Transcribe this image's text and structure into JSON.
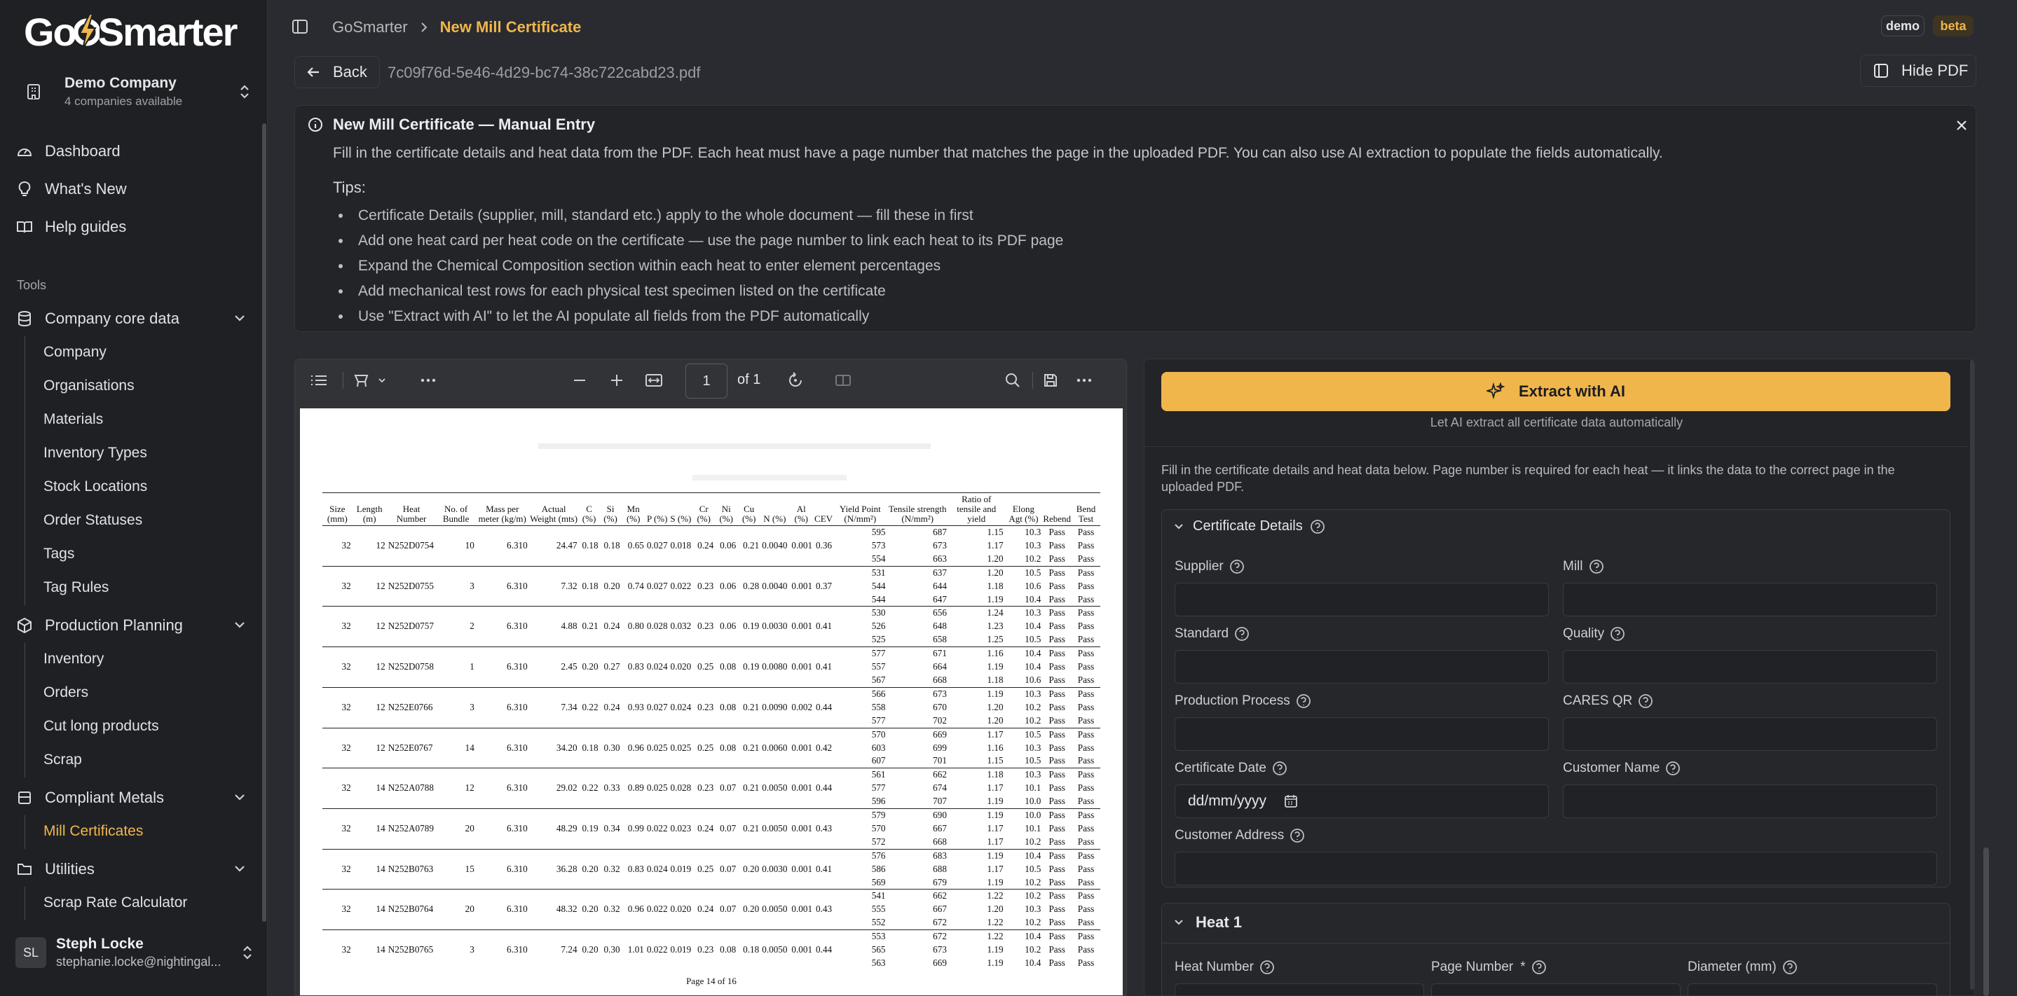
{
  "brand": {
    "logo_text_pre": "Go",
    "logo_text_post": "Smarter"
  },
  "company": {
    "name": "Demo Company",
    "sub": "4 companies available"
  },
  "nav": {
    "dashboard": "Dashboard",
    "whats_new": "What's New",
    "help": "Help guides"
  },
  "tools_label": "Tools",
  "groups": {
    "core": {
      "label": "Company core data",
      "items": [
        "Company",
        "Organisations",
        "Materials",
        "Inventory Types",
        "Stock Locations",
        "Order Statuses",
        "Tags",
        "Tag Rules"
      ]
    },
    "planning": {
      "label": "Production Planning",
      "items": [
        "Inventory",
        "Orders",
        "Cut long products",
        "Scrap"
      ]
    },
    "metals": {
      "label": "Compliant Metals",
      "items": [
        "Mill Certificates"
      ]
    },
    "utilities": {
      "label": "Utilities",
      "items": [
        "Scrap Rate Calculator"
      ]
    }
  },
  "user": {
    "initials": "SL",
    "name": "Steph Locke",
    "email": "stephanie.locke@nightingal..."
  },
  "breadcrumb": {
    "root": "GoSmarter",
    "current": "New Mill Certificate"
  },
  "badges": {
    "demo": "demo",
    "beta": "beta"
  },
  "toolbar": {
    "back": "Back",
    "filename": "7c09f76d-5e46-4d29-bc74-38c722cabd23.pdf",
    "hide_pdf": "Hide PDF"
  },
  "info": {
    "title": "New Mill Certificate — Manual Entry",
    "desc": "Fill in the certificate details and heat data from the PDF. Each heat must have a page number that matches the page in the uploaded PDF. You can also use AI extraction to populate the fields automatically.",
    "tips_heading": "Tips:",
    "tips": [
      "Certificate Details (supplier, mill, standard etc.) apply to the whole document — fill these in first",
      "Add one heat card per heat code on the certificate — use the page number to link each heat to its PDF page",
      "Expand the Chemical Composition section within each heat to enter element percentages",
      "Add mechanical test rows for each physical test specimen listed on the certificate",
      "Use \"Extract with AI\" to let the AI populate all fields from the PDF automatically"
    ]
  },
  "pdf_viewer": {
    "page": "1",
    "of_pages": "of 1",
    "headers": [
      "Size (mm)",
      "Length (m)",
      "Heat Number",
      "No. of Bundle",
      "Mass per meter (kg/m)",
      "Actual Weight (mts)",
      "C (%)",
      "Si (%)",
      "Mn (%)",
      "P (%)",
      "S (%)",
      "Cr (%)",
      "Ni (%)",
      "Cu (%)",
      "N (%)",
      "Al (%)",
      "CEV",
      "Yield Point (N/mm²)",
      "Tensile strength (N/mm²)",
      "Ratio of tensile and yield",
      "Elong Agt (%)",
      "Rebend",
      "Bend Test"
    ],
    "rows": [
      {
        "size": "32",
        "len": "12",
        "heat": "N252D0754",
        "bundle": "10",
        "mass": "6.310",
        "weight": "24.47",
        "c": "0.18",
        "si": "0.18",
        "mn": "0.65",
        "p": "0.027",
        "s": "0.018",
        "cr": "0.24",
        "ni": "0.06",
        "cu": "0.21",
        "n": "0.0040",
        "al": "0.001",
        "cev": "0.36",
        "tests": [
          [
            "595",
            "687",
            "1.15",
            "10.3",
            "Pass",
            "Pass"
          ],
          [
            "573",
            "673",
            "1.17",
            "10.3",
            "Pass",
            "Pass"
          ],
          [
            "554",
            "663",
            "1.20",
            "10.2",
            "Pass",
            "Pass"
          ]
        ]
      },
      {
        "size": "32",
        "len": "12",
        "heat": "N252D0755",
        "bundle": "3",
        "mass": "6.310",
        "weight": "7.32",
        "c": "0.18",
        "si": "0.20",
        "mn": "0.74",
        "p": "0.027",
        "s": "0.022",
        "cr": "0.23",
        "ni": "0.06",
        "cu": "0.28",
        "n": "0.0040",
        "al": "0.001",
        "cev": "0.37",
        "tests": [
          [
            "531",
            "637",
            "1.20",
            "10.5",
            "Pass",
            "Pass"
          ],
          [
            "544",
            "644",
            "1.18",
            "10.6",
            "Pass",
            "Pass"
          ],
          [
            "544",
            "647",
            "1.19",
            "10.4",
            "Pass",
            "Pass"
          ]
        ]
      },
      {
        "size": "32",
        "len": "12",
        "heat": "N252D0757",
        "bundle": "2",
        "mass": "6.310",
        "weight": "4.88",
        "c": "0.21",
        "si": "0.24",
        "mn": "0.80",
        "p": "0.028",
        "s": "0.032",
        "cr": "0.23",
        "ni": "0.06",
        "cu": "0.19",
        "n": "0.0030",
        "al": "0.001",
        "cev": "0.41",
        "tests": [
          [
            "530",
            "656",
            "1.24",
            "10.3",
            "Pass",
            "Pass"
          ],
          [
            "526",
            "648",
            "1.23",
            "10.4",
            "Pass",
            "Pass"
          ],
          [
            "525",
            "658",
            "1.25",
            "10.5",
            "Pass",
            "Pass"
          ]
        ]
      },
      {
        "size": "32",
        "len": "12",
        "heat": "N252D0758",
        "bundle": "1",
        "mass": "6.310",
        "weight": "2.45",
        "c": "0.20",
        "si": "0.27",
        "mn": "0.83",
        "p": "0.024",
        "s": "0.020",
        "cr": "0.25",
        "ni": "0.08",
        "cu": "0.19",
        "n": "0.0080",
        "al": "0.001",
        "cev": "0.41",
        "tests": [
          [
            "577",
            "671",
            "1.16",
            "10.4",
            "Pass",
            "Pass"
          ],
          [
            "557",
            "664",
            "1.19",
            "10.4",
            "Pass",
            "Pass"
          ],
          [
            "567",
            "668",
            "1.18",
            "10.6",
            "Pass",
            "Pass"
          ]
        ]
      },
      {
        "size": "32",
        "len": "12",
        "heat": "N252E0766",
        "bundle": "3",
        "mass": "6.310",
        "weight": "7.34",
        "c": "0.22",
        "si": "0.24",
        "mn": "0.93",
        "p": "0.027",
        "s": "0.024",
        "cr": "0.23",
        "ni": "0.08",
        "cu": "0.21",
        "n": "0.0090",
        "al": "0.002",
        "cev": "0.44",
        "tests": [
          [
            "566",
            "673",
            "1.19",
            "10.3",
            "Pass",
            "Pass"
          ],
          [
            "558",
            "670",
            "1.20",
            "10.2",
            "Pass",
            "Pass"
          ],
          [
            "577",
            "702",
            "1.20",
            "10.2",
            "Pass",
            "Pass"
          ]
        ]
      },
      {
        "size": "32",
        "len": "12",
        "heat": "N252E0767",
        "bundle": "14",
        "mass": "6.310",
        "weight": "34.20",
        "c": "0.18",
        "si": "0.30",
        "mn": "0.96",
        "p": "0.025",
        "s": "0.025",
        "cr": "0.25",
        "ni": "0.08",
        "cu": "0.21",
        "n": "0.0060",
        "al": "0.001",
        "cev": "0.42",
        "tests": [
          [
            "570",
            "669",
            "1.17",
            "10.5",
            "Pass",
            "Pass"
          ],
          [
            "603",
            "699",
            "1.16",
            "10.3",
            "Pass",
            "Pass"
          ],
          [
            "607",
            "701",
            "1.15",
            "10.5",
            "Pass",
            "Pass"
          ]
        ]
      },
      {
        "size": "32",
        "len": "14",
        "heat": "N252A0788",
        "bundle": "12",
        "mass": "6.310",
        "weight": "29.02",
        "c": "0.22",
        "si": "0.33",
        "mn": "0.89",
        "p": "0.025",
        "s": "0.028",
        "cr": "0.23",
        "ni": "0.07",
        "cu": "0.21",
        "n": "0.0050",
        "al": "0.001",
        "cev": "0.44",
        "tests": [
          [
            "561",
            "662",
            "1.18",
            "10.3",
            "Pass",
            "Pass"
          ],
          [
            "577",
            "674",
            "1.17",
            "10.1",
            "Pass",
            "Pass"
          ],
          [
            "596",
            "707",
            "1.19",
            "10.0",
            "Pass",
            "Pass"
          ]
        ]
      },
      {
        "size": "32",
        "len": "14",
        "heat": "N252A0789",
        "bundle": "20",
        "mass": "6.310",
        "weight": "48.29",
        "c": "0.19",
        "si": "0.34",
        "mn": "0.99",
        "p": "0.022",
        "s": "0.023",
        "cr": "0.24",
        "ni": "0.07",
        "cu": "0.21",
        "n": "0.0050",
        "al": "0.001",
        "cev": "0.43",
        "tests": [
          [
            "579",
            "690",
            "1.19",
            "10.0",
            "Pass",
            "Pass"
          ],
          [
            "570",
            "667",
            "1.17",
            "10.1",
            "Pass",
            "Pass"
          ],
          [
            "572",
            "668",
            "1.17",
            "10.2",
            "Pass",
            "Pass"
          ]
        ]
      },
      {
        "size": "32",
        "len": "14",
        "heat": "N252B0763",
        "bundle": "15",
        "mass": "6.310",
        "weight": "36.28",
        "c": "0.20",
        "si": "0.32",
        "mn": "0.83",
        "p": "0.024",
        "s": "0.019",
        "cr": "0.25",
        "ni": "0.07",
        "cu": "0.20",
        "n": "0.0030",
        "al": "0.001",
        "cev": "0.41",
        "tests": [
          [
            "576",
            "683",
            "1.19",
            "10.4",
            "Pass",
            "Pass"
          ],
          [
            "586",
            "688",
            "1.17",
            "10.5",
            "Pass",
            "Pass"
          ],
          [
            "569",
            "679",
            "1.19",
            "10.2",
            "Pass",
            "Pass"
          ]
        ]
      },
      {
        "size": "32",
        "len": "14",
        "heat": "N252B0764",
        "bundle": "20",
        "mass": "6.310",
        "weight": "48.32",
        "c": "0.20",
        "si": "0.32",
        "mn": "0.96",
        "p": "0.022",
        "s": "0.020",
        "cr": "0.24",
        "ni": "0.07",
        "cu": "0.20",
        "n": "0.0050",
        "al": "0.001",
        "cev": "0.43",
        "tests": [
          [
            "541",
            "662",
            "1.22",
            "10.2",
            "Pass",
            "Pass"
          ],
          [
            "555",
            "667",
            "1.20",
            "10.3",
            "Pass",
            "Pass"
          ],
          [
            "552",
            "672",
            "1.22",
            "10.2",
            "Pass",
            "Pass"
          ]
        ]
      },
      {
        "size": "32",
        "len": "14",
        "heat": "N252B0765",
        "bundle": "3",
        "mass": "6.310",
        "weight": "7.24",
        "c": "0.20",
        "si": "0.30",
        "mn": "1.01",
        "p": "0.022",
        "s": "0.019",
        "cr": "0.23",
        "ni": "0.08",
        "cu": "0.18",
        "n": "0.0050",
        "al": "0.001",
        "cev": "0.44",
        "tests": [
          [
            "553",
            "672",
            "1.22",
            "10.4",
            "Pass",
            "Pass"
          ],
          [
            "565",
            "673",
            "1.19",
            "10.2",
            "Pass",
            "Pass"
          ],
          [
            "563",
            "669",
            "1.19",
            "10.4",
            "Pass",
            "Pass"
          ]
        ]
      }
    ],
    "page_footer": "Page 14 of 16"
  },
  "form": {
    "extract_label": "Extract with AI",
    "extract_sub": "Let AI extract all certificate data automatically",
    "desc": "Fill in the certificate details and heat data below. Page number is required for each heat — it links the data to the correct page in the uploaded PDF.",
    "cert_title": "Certificate Details",
    "labels": {
      "supplier": "Supplier",
      "mill": "Mill",
      "standard": "Standard",
      "quality": "Quality",
      "process": "Production Process",
      "cares": "CARES QR",
      "cert_date": "Certificate Date",
      "customer_name": "Customer Name",
      "customer_address": "Customer Address"
    },
    "date_placeholder": "dd/mm/yyyy",
    "heat_title": "Heat 1",
    "heat_labels": {
      "heat_number": "Heat Number",
      "page_number": "Page Number",
      "required": "*",
      "diameter": "Diameter (mm)"
    }
  },
  "colors": {
    "accent": "#f0b64b",
    "background": "#2a2b30",
    "sidebar": "#1f2024"
  }
}
